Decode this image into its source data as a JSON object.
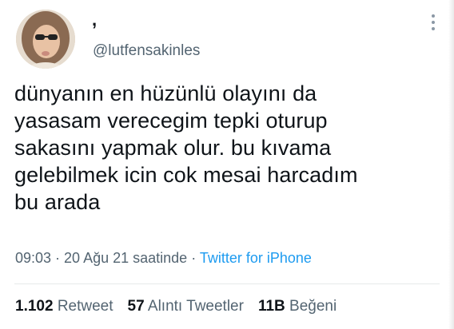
{
  "user": {
    "display_name": ",",
    "handle": "@lutfensakinles"
  },
  "tweet": {
    "lines": [
      "dünyanın en hüzünlü olayını da",
      "yasasam verecegim tepki oturup",
      "sakasını yapmak olur. bu kıvama",
      "gelebilmek icin cok mesai harcadım",
      "bu arada"
    ]
  },
  "meta": {
    "timestamp": "09:03 · 20 Ağu 21 saatinde",
    "separator": " · ",
    "source": "Twitter for iPhone"
  },
  "stats": {
    "retweets_count": "1.102",
    "retweets_label": "Retweet",
    "quotes_count": "57",
    "quotes_label": "Alıntı Tweetler",
    "likes_count": "11B",
    "likes_label": "Beğeni"
  },
  "icons": {
    "more": "more-vertical-icon"
  },
  "colors": {
    "text": "#0f1419",
    "secondary": "#536471",
    "link": "#1d9bf0",
    "divider": "#e7e9ea"
  }
}
